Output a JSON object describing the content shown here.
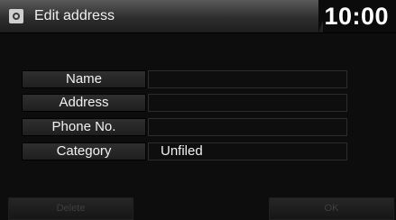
{
  "header": {
    "title": "Edit address",
    "clock": "10:00"
  },
  "fields": [
    {
      "label": "Name",
      "value": ""
    },
    {
      "label": "Address",
      "value": ""
    },
    {
      "label": "Phone No.",
      "value": ""
    },
    {
      "label": "Category",
      "value": "Unfiled"
    }
  ],
  "buttons": {
    "delete": "Delete",
    "ok": "OK"
  },
  "icons": {
    "header": "settings-icon"
  }
}
